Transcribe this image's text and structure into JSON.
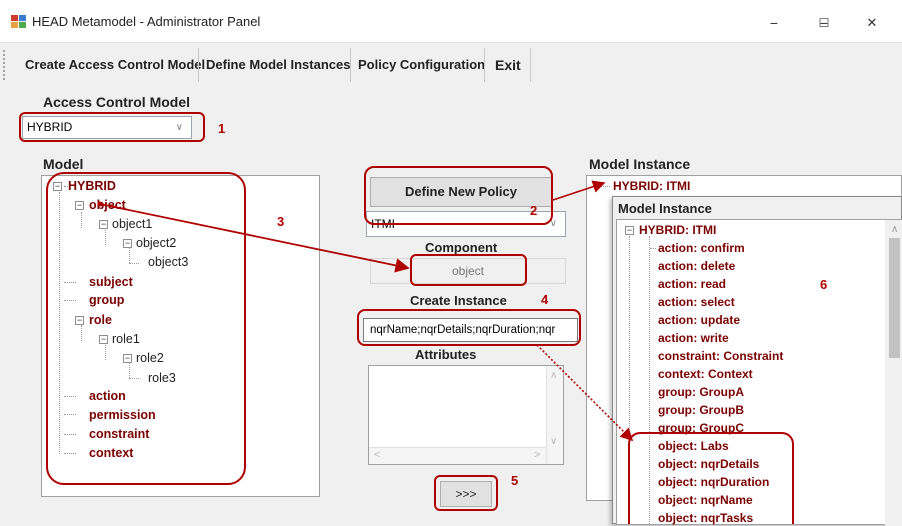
{
  "window": {
    "title": "HEAD Metamodel - Administrator Panel",
    "minimize": "−",
    "maximize": "☐",
    "close": "✕"
  },
  "menu": [
    "Create Access Control Model",
    "Define Model Instances",
    "Policy Configuration",
    "Exit"
  ],
  "access_control": {
    "label": "Access Control Model",
    "selected": "HYBRID"
  },
  "model": {
    "label": "Model",
    "root": "HYBRID",
    "items": [
      "object",
      "object1",
      "object2",
      "object3",
      "subject",
      "group",
      "role",
      "role1",
      "role2",
      "role3",
      "action",
      "permission",
      "constraint",
      "context"
    ]
  },
  "middle": {
    "define_policy": "Define New Policy",
    "policy_selected": "ITMI",
    "component_label": "Component",
    "component_value": "object",
    "create_instance_label": "Create Instance",
    "create_instance_value": "nqrName;nqrDetails;nqrDuration;nqr",
    "attributes_label": "Attributes",
    "move_button": ">>>"
  },
  "model_instance": {
    "label": "Model Instance",
    "root": "HYBRID: ITMI",
    "popup_title": "Model Instance",
    "popup_root": "HYBRID: ITMI",
    "items": [
      "action: confirm",
      "action: delete",
      "action: read",
      "action: select",
      "action: update",
      "action: write",
      "constraint: Constraint",
      "context: Context",
      "group: GroupA",
      "group: GroupB",
      "group: GroupC",
      "object: Labs",
      "object: nqrDetails",
      "object: nqrDuration",
      "object: nqrName",
      "object: nqrTasks"
    ]
  },
  "annotations": [
    "1",
    "2",
    "3",
    "4",
    "5",
    "6"
  ],
  "colors": {
    "annotation": "#b00000",
    "tree_item": "#7a0000"
  }
}
